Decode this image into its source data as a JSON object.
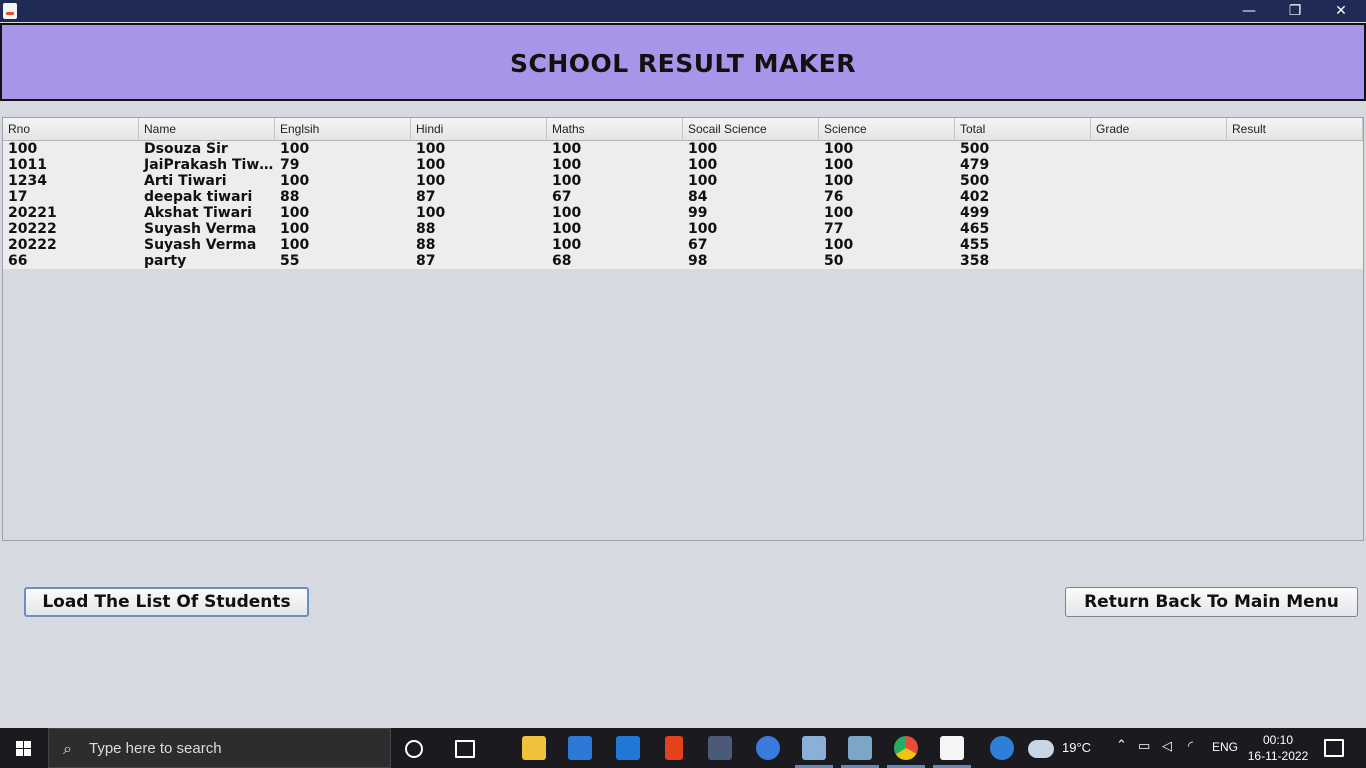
{
  "window": {
    "minimize_glyph": "—",
    "maximize_glyph": "❐",
    "close_glyph": "✕"
  },
  "header": {
    "title": "SCHOOL RESULT MAKER"
  },
  "table": {
    "columns": [
      "Rno",
      "Name",
      "Englsih",
      "Hindi",
      "Maths",
      "Socail Science",
      "Science",
      "Total",
      "Grade",
      "Result"
    ],
    "rows": [
      [
        "100",
        "Dsouza Sir",
        "100",
        "100",
        "100",
        "100",
        "100",
        "500",
        "",
        ""
      ],
      [
        "1011",
        "JaiPrakash Tiwari",
        "79",
        "100",
        "100",
        "100",
        "100",
        "479",
        "",
        ""
      ],
      [
        "1234",
        "Arti Tiwari",
        "100",
        "100",
        "100",
        "100",
        "100",
        "500",
        "",
        ""
      ],
      [
        "17",
        "deepak tiwari",
        "88",
        "87",
        "67",
        "84",
        "76",
        "402",
        "",
        ""
      ],
      [
        "20221",
        "Akshat Tiwari",
        "100",
        "100",
        "100",
        "99",
        "100",
        "499",
        "",
        ""
      ],
      [
        "20222",
        "Suyash Verma",
        "100",
        "88",
        "100",
        "100",
        "77",
        "465",
        "",
        ""
      ],
      [
        "20222",
        "Suyash Verma",
        "100",
        "88",
        "100",
        "67",
        "100",
        "455",
        "",
        ""
      ],
      [
        "66",
        "party",
        "55",
        "87",
        "68",
        "98",
        "50",
        "358",
        "",
        ""
      ]
    ]
  },
  "buttons": {
    "load_label": "Load The List Of Students",
    "return_label": "Return Back To Main Menu"
  },
  "taskbar": {
    "search_placeholder": "Type here to search",
    "weather_temp": "19°C",
    "language": "ENG",
    "time": "00:10",
    "date": "16-11-2022",
    "icons": [
      "cortana-icon",
      "task-view-icon",
      "file-explorer-icon",
      "microsoft-store-icon",
      "mail-icon",
      "office-icon",
      "mysql-icon",
      "firefox-icon",
      "virtualbox-icon",
      "photos-icon",
      "chrome-icon",
      "java-icon",
      "help-icon",
      "weather-icon"
    ]
  },
  "colors": {
    "header_bg": "#a695e8",
    "titlebar_bg": "#1f2a55",
    "taskbar_bg": "#1b1b1f"
  }
}
